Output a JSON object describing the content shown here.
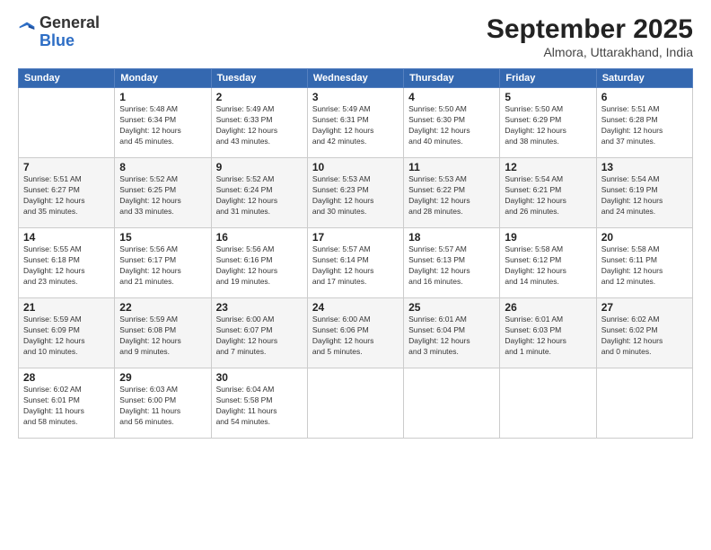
{
  "header": {
    "logo_general": "General",
    "logo_blue": "Blue",
    "month_title": "September 2025",
    "location": "Almora, Uttarakhand, India"
  },
  "days_of_week": [
    "Sunday",
    "Monday",
    "Tuesday",
    "Wednesday",
    "Thursday",
    "Friday",
    "Saturday"
  ],
  "weeks": [
    [
      {
        "day": "",
        "info": ""
      },
      {
        "day": "1",
        "info": "Sunrise: 5:48 AM\nSunset: 6:34 PM\nDaylight: 12 hours\nand 45 minutes."
      },
      {
        "day": "2",
        "info": "Sunrise: 5:49 AM\nSunset: 6:33 PM\nDaylight: 12 hours\nand 43 minutes."
      },
      {
        "day": "3",
        "info": "Sunrise: 5:49 AM\nSunset: 6:31 PM\nDaylight: 12 hours\nand 42 minutes."
      },
      {
        "day": "4",
        "info": "Sunrise: 5:50 AM\nSunset: 6:30 PM\nDaylight: 12 hours\nand 40 minutes."
      },
      {
        "day": "5",
        "info": "Sunrise: 5:50 AM\nSunset: 6:29 PM\nDaylight: 12 hours\nand 38 minutes."
      },
      {
        "day": "6",
        "info": "Sunrise: 5:51 AM\nSunset: 6:28 PM\nDaylight: 12 hours\nand 37 minutes."
      }
    ],
    [
      {
        "day": "7",
        "info": "Sunrise: 5:51 AM\nSunset: 6:27 PM\nDaylight: 12 hours\nand 35 minutes."
      },
      {
        "day": "8",
        "info": "Sunrise: 5:52 AM\nSunset: 6:25 PM\nDaylight: 12 hours\nand 33 minutes."
      },
      {
        "day": "9",
        "info": "Sunrise: 5:52 AM\nSunset: 6:24 PM\nDaylight: 12 hours\nand 31 minutes."
      },
      {
        "day": "10",
        "info": "Sunrise: 5:53 AM\nSunset: 6:23 PM\nDaylight: 12 hours\nand 30 minutes."
      },
      {
        "day": "11",
        "info": "Sunrise: 5:53 AM\nSunset: 6:22 PM\nDaylight: 12 hours\nand 28 minutes."
      },
      {
        "day": "12",
        "info": "Sunrise: 5:54 AM\nSunset: 6:21 PM\nDaylight: 12 hours\nand 26 minutes."
      },
      {
        "day": "13",
        "info": "Sunrise: 5:54 AM\nSunset: 6:19 PM\nDaylight: 12 hours\nand 24 minutes."
      }
    ],
    [
      {
        "day": "14",
        "info": "Sunrise: 5:55 AM\nSunset: 6:18 PM\nDaylight: 12 hours\nand 23 minutes."
      },
      {
        "day": "15",
        "info": "Sunrise: 5:56 AM\nSunset: 6:17 PM\nDaylight: 12 hours\nand 21 minutes."
      },
      {
        "day": "16",
        "info": "Sunrise: 5:56 AM\nSunset: 6:16 PM\nDaylight: 12 hours\nand 19 minutes."
      },
      {
        "day": "17",
        "info": "Sunrise: 5:57 AM\nSunset: 6:14 PM\nDaylight: 12 hours\nand 17 minutes."
      },
      {
        "day": "18",
        "info": "Sunrise: 5:57 AM\nSunset: 6:13 PM\nDaylight: 12 hours\nand 16 minutes."
      },
      {
        "day": "19",
        "info": "Sunrise: 5:58 AM\nSunset: 6:12 PM\nDaylight: 12 hours\nand 14 minutes."
      },
      {
        "day": "20",
        "info": "Sunrise: 5:58 AM\nSunset: 6:11 PM\nDaylight: 12 hours\nand 12 minutes."
      }
    ],
    [
      {
        "day": "21",
        "info": "Sunrise: 5:59 AM\nSunset: 6:09 PM\nDaylight: 12 hours\nand 10 minutes."
      },
      {
        "day": "22",
        "info": "Sunrise: 5:59 AM\nSunset: 6:08 PM\nDaylight: 12 hours\nand 9 minutes."
      },
      {
        "day": "23",
        "info": "Sunrise: 6:00 AM\nSunset: 6:07 PM\nDaylight: 12 hours\nand 7 minutes."
      },
      {
        "day": "24",
        "info": "Sunrise: 6:00 AM\nSunset: 6:06 PM\nDaylight: 12 hours\nand 5 minutes."
      },
      {
        "day": "25",
        "info": "Sunrise: 6:01 AM\nSunset: 6:04 PM\nDaylight: 12 hours\nand 3 minutes."
      },
      {
        "day": "26",
        "info": "Sunrise: 6:01 AM\nSunset: 6:03 PM\nDaylight: 12 hours\nand 1 minute."
      },
      {
        "day": "27",
        "info": "Sunrise: 6:02 AM\nSunset: 6:02 PM\nDaylight: 12 hours\nand 0 minutes."
      }
    ],
    [
      {
        "day": "28",
        "info": "Sunrise: 6:02 AM\nSunset: 6:01 PM\nDaylight: 11 hours\nand 58 minutes."
      },
      {
        "day": "29",
        "info": "Sunrise: 6:03 AM\nSunset: 6:00 PM\nDaylight: 11 hours\nand 56 minutes."
      },
      {
        "day": "30",
        "info": "Sunrise: 6:04 AM\nSunset: 5:58 PM\nDaylight: 11 hours\nand 54 minutes."
      },
      {
        "day": "",
        "info": ""
      },
      {
        "day": "",
        "info": ""
      },
      {
        "day": "",
        "info": ""
      },
      {
        "day": "",
        "info": ""
      }
    ]
  ]
}
